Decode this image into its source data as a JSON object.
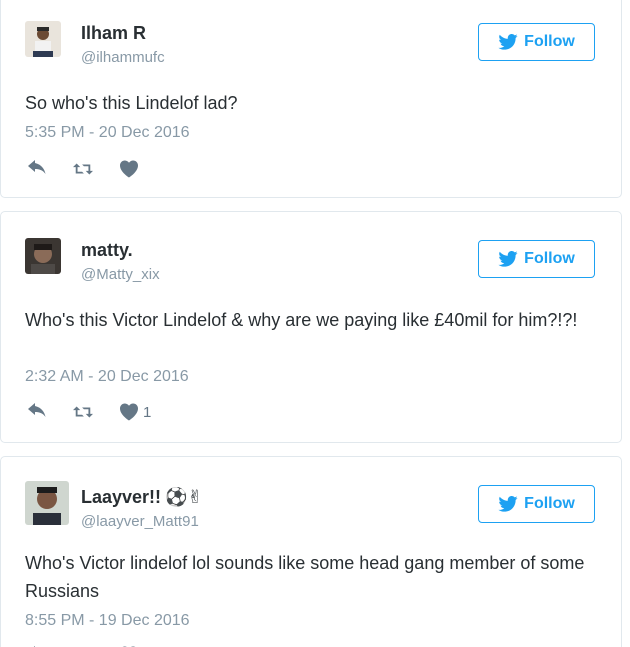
{
  "colors": {
    "accent": "#1da1f2",
    "muted": "#8899a6",
    "text": "#292f33",
    "border": "#e1e8ed"
  },
  "tweets": [
    {
      "name": "Ilham R",
      "handle": "@ilhammufc",
      "follow_label": "Follow",
      "text": "So who's this Lindelof lad?",
      "timestamp": "5:35 PM - 20 Dec 2016",
      "like_count": ""
    },
    {
      "name": "matty.",
      "handle": "@Matty_xix",
      "follow_label": "Follow",
      "text": "Who's this Victor Lindelof & why are we paying like £40mil for him?!?!",
      "timestamp": "2:32 AM - 20 Dec 2016",
      "like_count": "1"
    },
    {
      "name": "Laayver!!",
      "name_emoji": "⚽✌",
      "handle": "@laayver_Matt91",
      "follow_label": "Follow",
      "text": "Who's Victor lindelof lol sounds like some head gang member of some Russians",
      "timestamp": "8:55 PM - 19 Dec 2016",
      "like_count": ""
    }
  ]
}
